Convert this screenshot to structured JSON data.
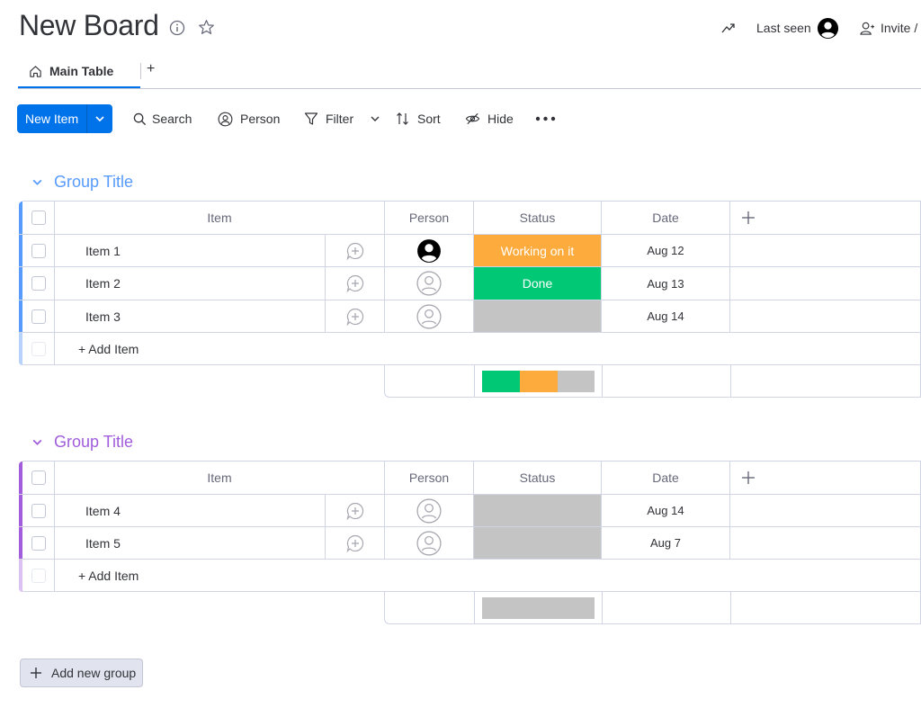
{
  "board": {
    "title": "New Board",
    "last_seen_label": "Last seen",
    "invite_label": "Invite /"
  },
  "tabs": {
    "main": "Main Table",
    "add": "+"
  },
  "toolbar": {
    "new_item": "New Item",
    "search": "Search",
    "person": "Person",
    "filter": "Filter",
    "sort": "Sort",
    "hide": "Hide"
  },
  "columns": {
    "item": "Item",
    "person": "Person",
    "status": "Status",
    "date": "Date",
    "add": "+"
  },
  "colors": {
    "accent": "#0073ea",
    "group1": "#579bfc",
    "group2": "#a25ddc",
    "working": "#fdab3d",
    "done": "#00c875",
    "empty_status": "#c4c4c4"
  },
  "groups": [
    {
      "title": "Group Title",
      "add_item": "+ Add Item",
      "items": [
        {
          "name": "Item 1",
          "person": "assigned",
          "status": "Working on it",
          "date": "Aug 12"
        },
        {
          "name": "Item 2",
          "person": "empty",
          "status": "Done",
          "date": "Aug 13"
        },
        {
          "name": "Item 3",
          "person": "empty",
          "status": "",
          "date": "Aug 14"
        }
      ],
      "status_summary": [
        {
          "status": "Done",
          "fraction": 0.333
        },
        {
          "status": "Working on it",
          "fraction": 0.333
        },
        {
          "status": "",
          "fraction": 0.334
        }
      ]
    },
    {
      "title": "Group Title",
      "add_item": "+ Add Item",
      "items": [
        {
          "name": "Item 4",
          "person": "empty",
          "status": "",
          "date": "Aug 14"
        },
        {
          "name": "Item 5",
          "person": "empty",
          "status": "",
          "date": "Aug 7"
        }
      ],
      "status_summary": [
        {
          "status": "",
          "fraction": 1.0
        }
      ]
    }
  ],
  "add_group": "Add new group",
  "icons": [
    "info-icon",
    "star-icon",
    "activity-icon",
    "avatar-icon",
    "invite-icon",
    "home-icon",
    "search-icon",
    "person-icon",
    "filter-icon",
    "sort-icon",
    "hide-icon",
    "more-icon",
    "chevron-down-icon",
    "add-update-icon",
    "plus-icon"
  ]
}
